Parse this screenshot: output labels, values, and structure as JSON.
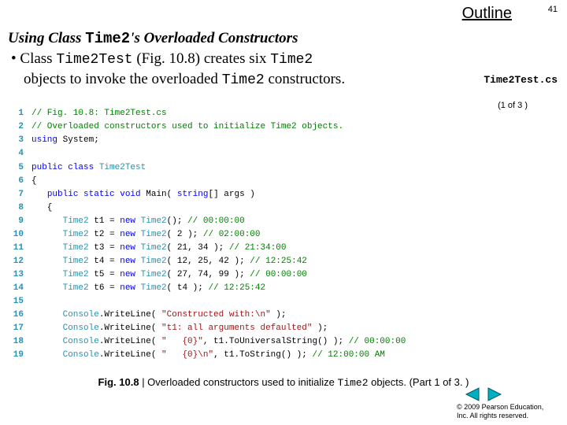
{
  "outline": "Outline",
  "page_number": "41",
  "heading": {
    "prefix": "Using Class ",
    "mono": "Time2",
    "suffix": "'s Overloaded Constructors"
  },
  "bullet": {
    "p1": "Class ",
    "m1": "Time2Test",
    "p2": " (Fig. 10.8) creates six ",
    "m2": "Time2",
    "p3": "objects to invoke the overloaded ",
    "m3": "Time2",
    "p4": " constructors."
  },
  "side_label": "Time2Test.cs",
  "part_label": "(1 of 3 )",
  "code": [
    {
      "n": "1",
      "seg": [
        {
          "c": "cm",
          "t": "// Fig. 10.8: Time2Test.cs"
        }
      ]
    },
    {
      "n": "2",
      "seg": [
        {
          "c": "cm",
          "t": "// Overloaded constructors used to initialize Time2 objects."
        }
      ]
    },
    {
      "n": "3",
      "seg": [
        {
          "c": "kw",
          "t": "using"
        },
        {
          "c": "",
          "t": " System;"
        }
      ]
    },
    {
      "n": "4",
      "seg": [
        {
          "c": "",
          "t": ""
        }
      ]
    },
    {
      "n": "5",
      "seg": [
        {
          "c": "kw",
          "t": "public class"
        },
        {
          "c": "",
          "t": " "
        },
        {
          "c": "ty",
          "t": "Time2Test"
        }
      ]
    },
    {
      "n": "6",
      "seg": [
        {
          "c": "",
          "t": "{"
        }
      ]
    },
    {
      "n": "7",
      "seg": [
        {
          "c": "",
          "t": "   "
        },
        {
          "c": "kw",
          "t": "public static void"
        },
        {
          "c": "",
          "t": " Main( "
        },
        {
          "c": "kw",
          "t": "string"
        },
        {
          "c": "",
          "t": "[] args )"
        }
      ]
    },
    {
      "n": "8",
      "seg": [
        {
          "c": "",
          "t": "   {"
        }
      ]
    },
    {
      "n": "9",
      "seg": [
        {
          "c": "",
          "t": "      "
        },
        {
          "c": "ty",
          "t": "Time2"
        },
        {
          "c": "",
          "t": " t1 = "
        },
        {
          "c": "kw",
          "t": "new"
        },
        {
          "c": "",
          "t": " "
        },
        {
          "c": "ty",
          "t": "Time2"
        },
        {
          "c": "",
          "t": "(); "
        },
        {
          "c": "cm",
          "t": "// 00:00:00"
        }
      ]
    },
    {
      "n": "10",
      "seg": [
        {
          "c": "",
          "t": "      "
        },
        {
          "c": "ty",
          "t": "Time2"
        },
        {
          "c": "",
          "t": " t2 = "
        },
        {
          "c": "kw",
          "t": "new"
        },
        {
          "c": "",
          "t": " "
        },
        {
          "c": "ty",
          "t": "Time2"
        },
        {
          "c": "",
          "t": "( 2 ); "
        },
        {
          "c": "cm",
          "t": "// 02:00:00"
        }
      ]
    },
    {
      "n": "11",
      "seg": [
        {
          "c": "",
          "t": "      "
        },
        {
          "c": "ty",
          "t": "Time2"
        },
        {
          "c": "",
          "t": " t3 = "
        },
        {
          "c": "kw",
          "t": "new"
        },
        {
          "c": "",
          "t": " "
        },
        {
          "c": "ty",
          "t": "Time2"
        },
        {
          "c": "",
          "t": "( 21, 34 ); "
        },
        {
          "c": "cm",
          "t": "// 21:34:00"
        }
      ]
    },
    {
      "n": "12",
      "seg": [
        {
          "c": "",
          "t": "      "
        },
        {
          "c": "ty",
          "t": "Time2"
        },
        {
          "c": "",
          "t": " t4 = "
        },
        {
          "c": "kw",
          "t": "new"
        },
        {
          "c": "",
          "t": " "
        },
        {
          "c": "ty",
          "t": "Time2"
        },
        {
          "c": "",
          "t": "( 12, 25, 42 ); "
        },
        {
          "c": "cm",
          "t": "// 12:25:42"
        }
      ]
    },
    {
      "n": "13",
      "seg": [
        {
          "c": "",
          "t": "      "
        },
        {
          "c": "ty",
          "t": "Time2"
        },
        {
          "c": "",
          "t": " t5 = "
        },
        {
          "c": "kw",
          "t": "new"
        },
        {
          "c": "",
          "t": " "
        },
        {
          "c": "ty",
          "t": "Time2"
        },
        {
          "c": "",
          "t": "( 27, 74, 99 ); "
        },
        {
          "c": "cm",
          "t": "// 00:00:00"
        }
      ]
    },
    {
      "n": "14",
      "seg": [
        {
          "c": "",
          "t": "      "
        },
        {
          "c": "ty",
          "t": "Time2"
        },
        {
          "c": "",
          "t": " t6 = "
        },
        {
          "c": "kw",
          "t": "new"
        },
        {
          "c": "",
          "t": " "
        },
        {
          "c": "ty",
          "t": "Time2"
        },
        {
          "c": "",
          "t": "( t4 ); "
        },
        {
          "c": "cm",
          "t": "// 12:25:42"
        }
      ]
    },
    {
      "n": "15",
      "seg": [
        {
          "c": "",
          "t": ""
        }
      ]
    },
    {
      "n": "16",
      "seg": [
        {
          "c": "",
          "t": "      "
        },
        {
          "c": "ty",
          "t": "Console"
        },
        {
          "c": "",
          "t": ".WriteLine( "
        },
        {
          "c": "st",
          "t": "\"Constructed with:\\n\""
        },
        {
          "c": "",
          "t": " );"
        }
      ]
    },
    {
      "n": "17",
      "seg": [
        {
          "c": "",
          "t": "      "
        },
        {
          "c": "ty",
          "t": "Console"
        },
        {
          "c": "",
          "t": ".WriteLine( "
        },
        {
          "c": "st",
          "t": "\"t1: all arguments defaulted\""
        },
        {
          "c": "",
          "t": " );"
        }
      ]
    },
    {
      "n": "18",
      "seg": [
        {
          "c": "",
          "t": "      "
        },
        {
          "c": "ty",
          "t": "Console"
        },
        {
          "c": "",
          "t": ".WriteLine( "
        },
        {
          "c": "st",
          "t": "\"   {0}\""
        },
        {
          "c": "",
          "t": ", t1.ToUniversalString() ); "
        },
        {
          "c": "cm",
          "t": "// 00:00:00"
        }
      ]
    },
    {
      "n": "19",
      "seg": [
        {
          "c": "",
          "t": "      "
        },
        {
          "c": "ty",
          "t": "Console"
        },
        {
          "c": "",
          "t": ".WriteLine( "
        },
        {
          "c": "st",
          "t": "\"   {0}\\n\""
        },
        {
          "c": "",
          "t": ", t1.ToString() ); "
        },
        {
          "c": "cm",
          "t": "// 12:00:00 AM"
        }
      ]
    }
  ],
  "caption": {
    "fig": "Fig. 10.8 ",
    "text1": "| Overloaded constructors used to initialize ",
    "mono": "Time2",
    "text2": " objects. (Part 1 of 3. )"
  },
  "copyright": {
    "line1": "© 2009 Pearson Education,",
    "line2": "Inc.  All rights reserved."
  }
}
